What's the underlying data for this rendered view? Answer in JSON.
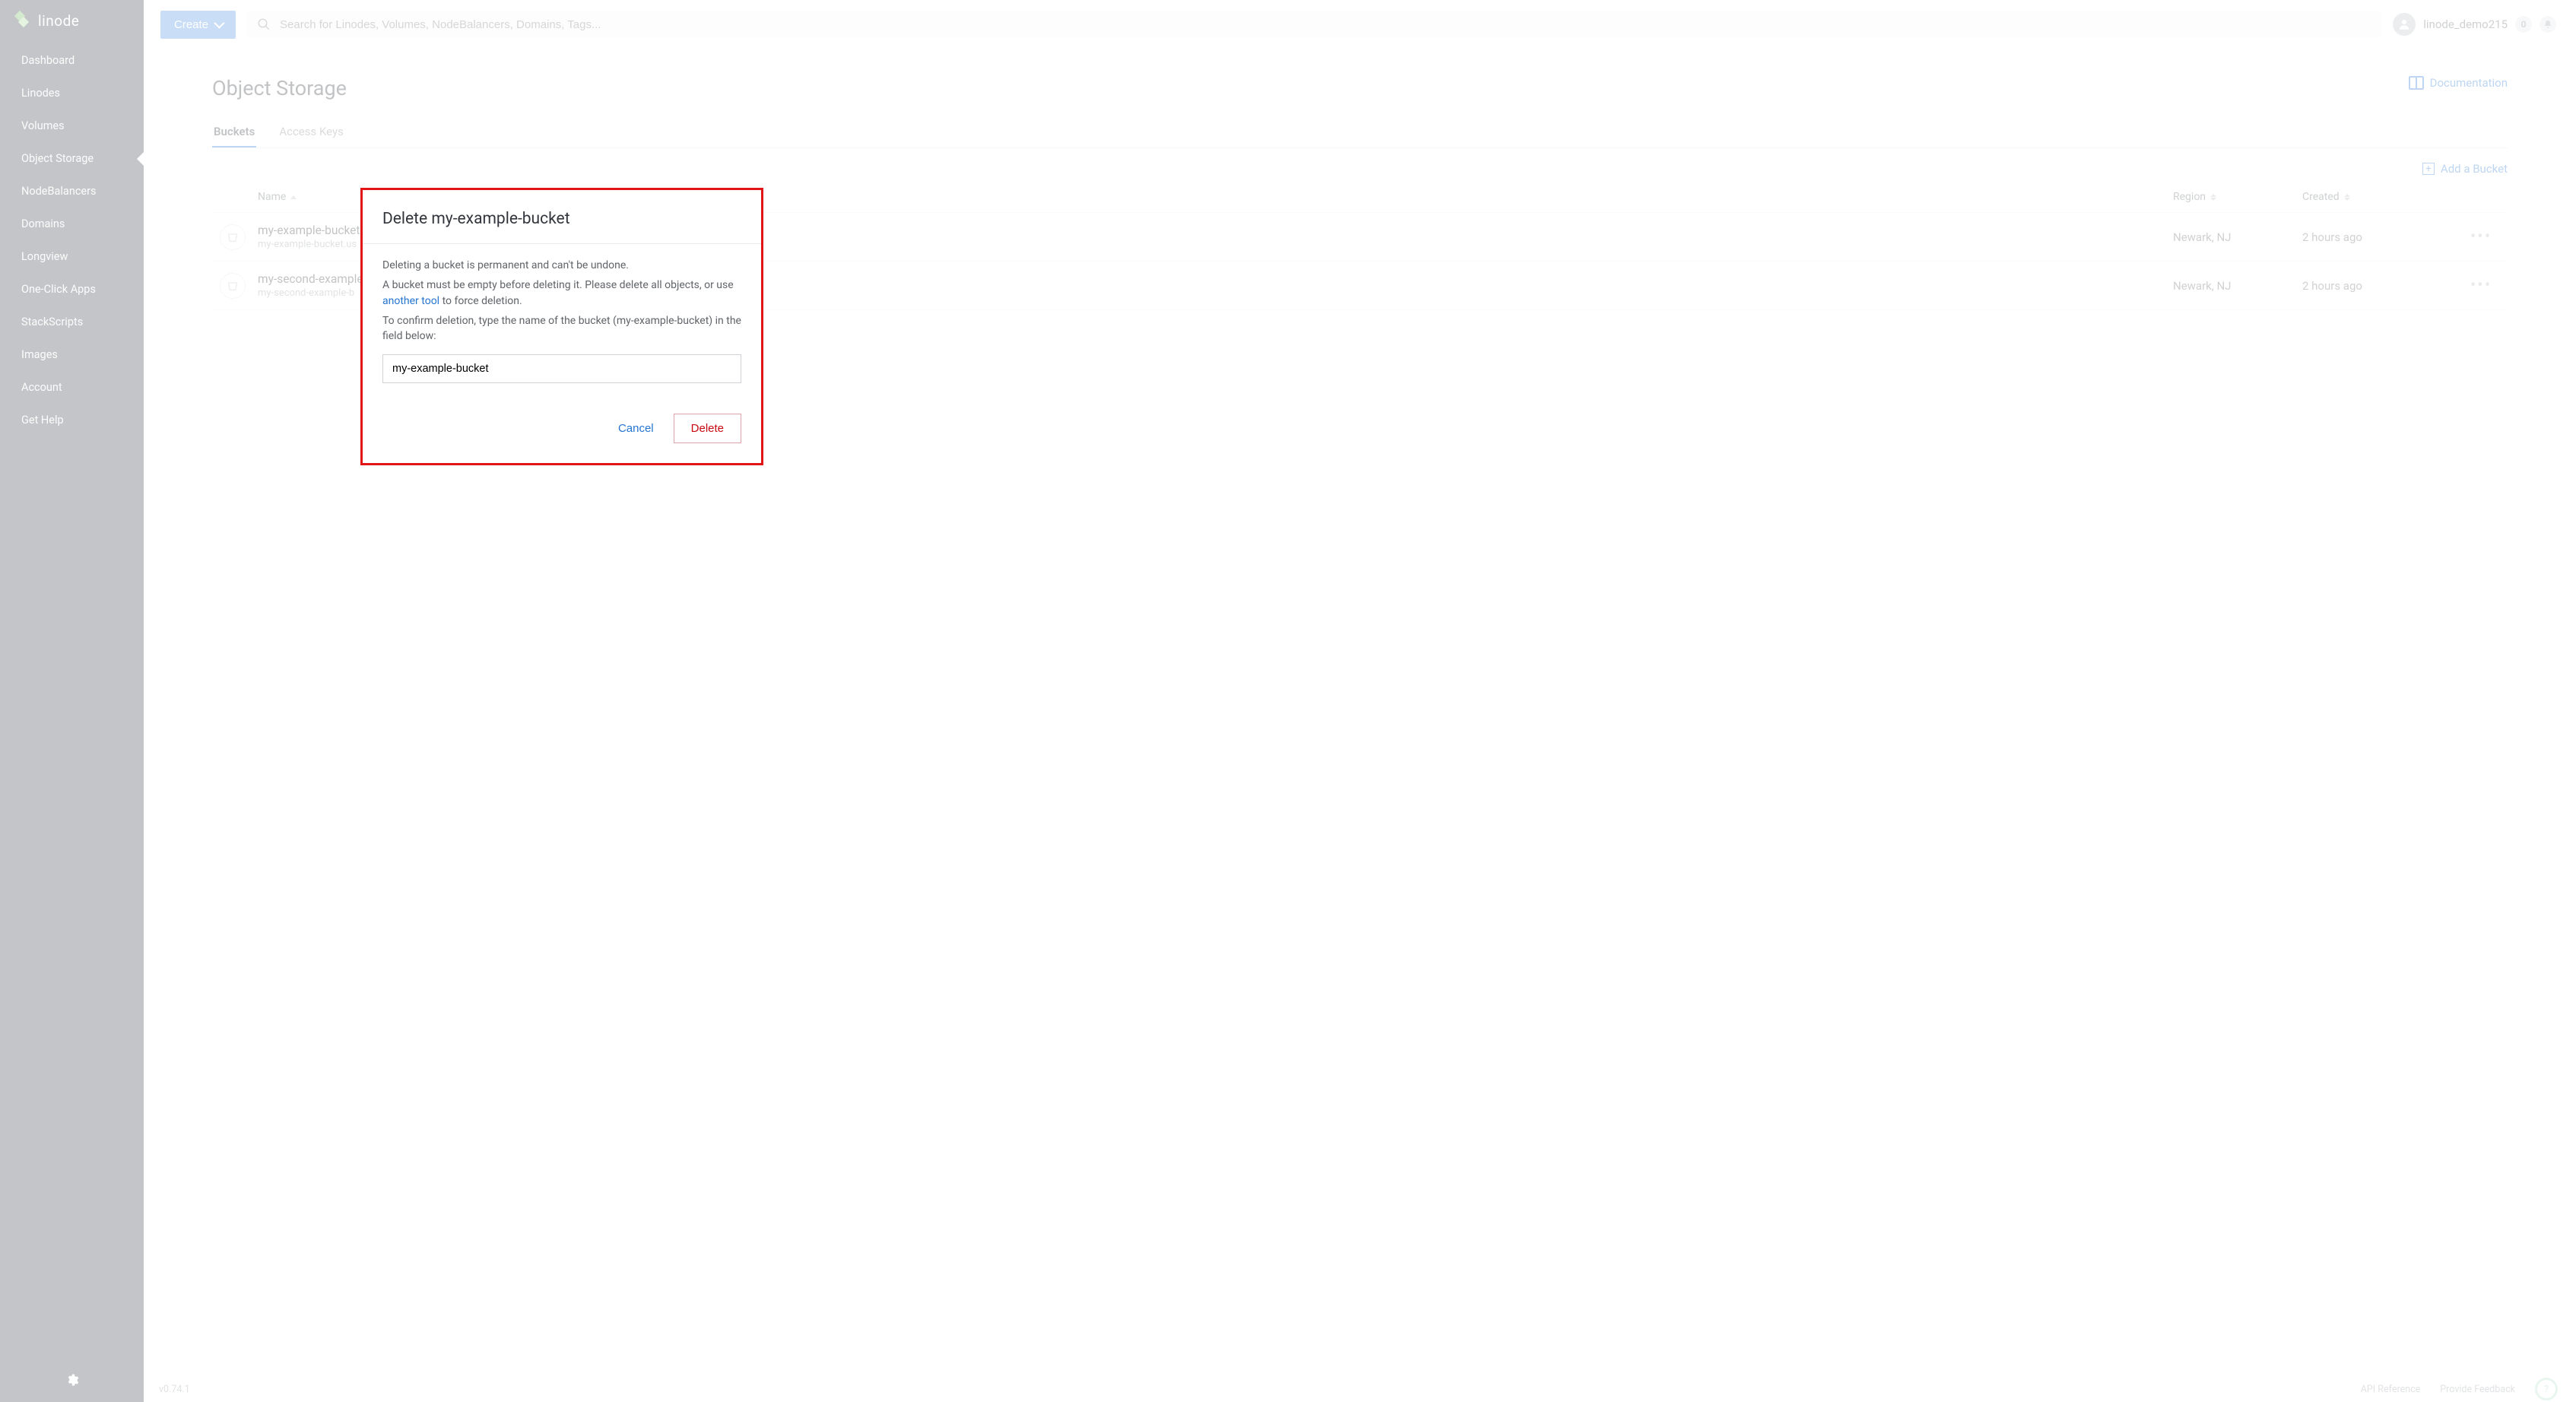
{
  "brand": "linode",
  "sidebar": {
    "items": [
      {
        "label": "Dashboard"
      },
      {
        "label": "Linodes"
      },
      {
        "label": "Volumes"
      },
      {
        "label": "Object Storage",
        "active": true
      },
      {
        "label": "NodeBalancers"
      },
      {
        "label": "Domains"
      },
      {
        "label": "Longview"
      },
      {
        "label": "One-Click Apps"
      },
      {
        "label": "StackScripts"
      },
      {
        "label": "Images"
      },
      {
        "label": "Account"
      },
      {
        "label": "Get Help"
      }
    ]
  },
  "topbar": {
    "create_label": "Create",
    "search_placeholder": "Search for Linodes, Volumes, NodeBalancers, Domains, Tags...",
    "username": "linode_demo215",
    "notify_count": "0"
  },
  "page": {
    "title": "Object Storage",
    "doc_link": "Documentation",
    "tabs": [
      {
        "label": "Buckets",
        "active": true
      },
      {
        "label": "Access Keys"
      }
    ],
    "add_label": "Add a Bucket",
    "columns": {
      "name": "Name",
      "region": "Region",
      "created": "Created"
    },
    "rows": [
      {
        "name": "my-example-bucket",
        "sub": "my-example-bucket.us",
        "region": "Newark, NJ",
        "created": "2 hours ago"
      },
      {
        "name": "my-second-example",
        "sub": "my-second-example-b",
        "region": "Newark, NJ",
        "created": "2 hours ago"
      }
    ]
  },
  "bottombar": {
    "version": "v0.74.1",
    "api_ref": "API Reference",
    "feedback": "Provide Feedback"
  },
  "modal": {
    "title": "Delete my-example-bucket",
    "p1": "Deleting a bucket is permanent and can't be undone.",
    "p2_a": "A bucket must be empty before deleting it. Please delete all objects, or use ",
    "p2_link": "another tool",
    "p2_b": " to force deletion.",
    "p3": "To confirm deletion, type the name of the bucket (my-example-bucket) in the field below:",
    "input_value": "my-example-bucket",
    "cancel": "Cancel",
    "delete": "Delete"
  }
}
